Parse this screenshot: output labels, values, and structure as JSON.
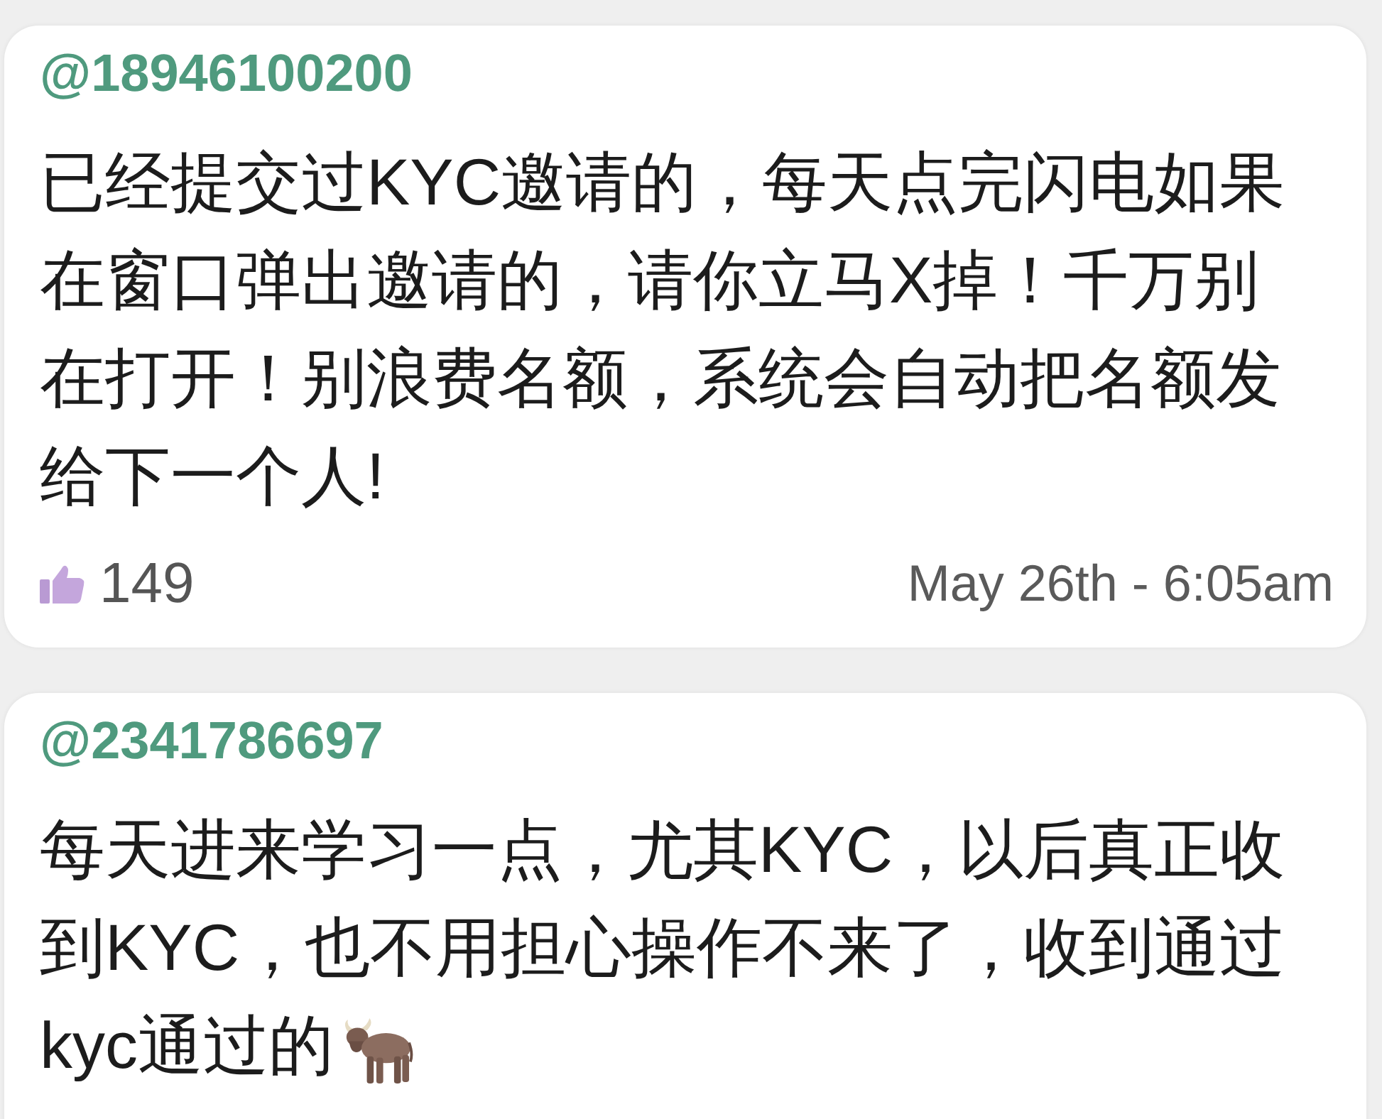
{
  "comments": [
    {
      "username": "@18946100200",
      "lines": [
        "已经提交过KYC邀请的，每天点完闪电如果",
        "在窗口弹出邀请的，请你立马X掉！千万别",
        "在打开！别浪费名额，系统会自动把名额发",
        "给下一个人!"
      ],
      "likes": "149",
      "timestamp": "May 26th - 6:05am"
    },
    {
      "username": "@2341786697",
      "lines": [
        "每天进来学习一点，尤其KYC，以后真正收",
        "到KYC，也不用担心操作不来了，收到通过",
        "kyc通过的"
      ],
      "trailing_emoji": {
        "kind": "ox"
      }
    }
  ]
}
